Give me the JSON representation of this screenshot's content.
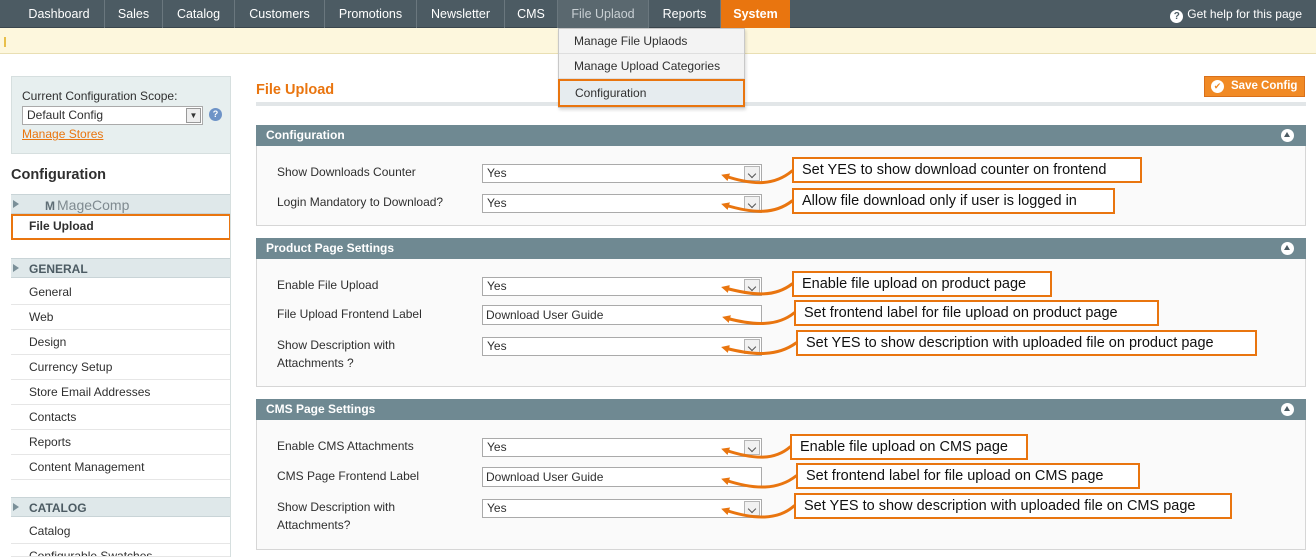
{
  "nav": {
    "items": [
      "Dashboard",
      "Sales",
      "Catalog",
      "Customers",
      "Promotions",
      "Newsletter",
      "CMS",
      "File Uplaod",
      "Reports",
      "System"
    ],
    "help": "Get help for this page"
  },
  "dropdown": [
    "Manage File Uplaods",
    "Manage Upload Categories",
    "Configuration"
  ],
  "scope": {
    "label": "Current Configuration Scope:",
    "value": "Default Config",
    "manage_stores": "Manage Stores"
  },
  "sidebar": {
    "title": "Configuration",
    "vendor": "MageComp",
    "vendor_mark": "M",
    "vendor_item": "File Upload",
    "general_heading": "GENERAL",
    "general_items": [
      "General",
      "Web",
      "Design",
      "Currency Setup",
      "Store Email Addresses",
      "Contacts",
      "Reports",
      "Content Management"
    ],
    "catalog_heading": "CATALOG",
    "catalog_items": [
      "Catalog",
      "Configurable Swatches"
    ]
  },
  "main": {
    "page_title": "File Upload",
    "save_label": "Save Config",
    "save_icon": "check-icon",
    "sections": [
      {
        "title": "Configuration",
        "fields": [
          {
            "label": "Show Downloads Counter",
            "value": "Yes",
            "note": "Set YES to show download counter on frontend"
          },
          {
            "label": "Login Mandatory to Download?",
            "value": "Yes",
            "note": "Allow file download only if user is logged in"
          }
        ]
      },
      {
        "title": "Product Page Settings",
        "fields": [
          {
            "label": "Enable File Upload",
            "value": "Yes",
            "note": "Enable file upload on product page"
          },
          {
            "label": "File Upload Frontend Label",
            "value": "Download User Guide",
            "note": "Set frontend label for file upload on product page"
          },
          {
            "label_lines": [
              "Show Description with",
              "Attachments ?"
            ],
            "value": "Yes",
            "note": "Set YES to show description with uploaded file on product page"
          }
        ]
      },
      {
        "title": "CMS Page Settings",
        "fields": [
          {
            "label": "Enable CMS Attachments",
            "value": "Yes",
            "note": "Enable file upload on CMS page"
          },
          {
            "label": "CMS Page Frontend Label",
            "value": "Download User Guide",
            "note": "Set frontend label for file upload on CMS page"
          },
          {
            "label_lines": [
              "Show Description with",
              "Attachments?"
            ],
            "value": "Yes",
            "note": "Set YES to show description with uploaded file on CMS page"
          }
        ]
      }
    ]
  },
  "colors": {
    "accent": "#e9750f",
    "nav_bg": "#4c5b63",
    "section_header": "#6f8992"
  }
}
